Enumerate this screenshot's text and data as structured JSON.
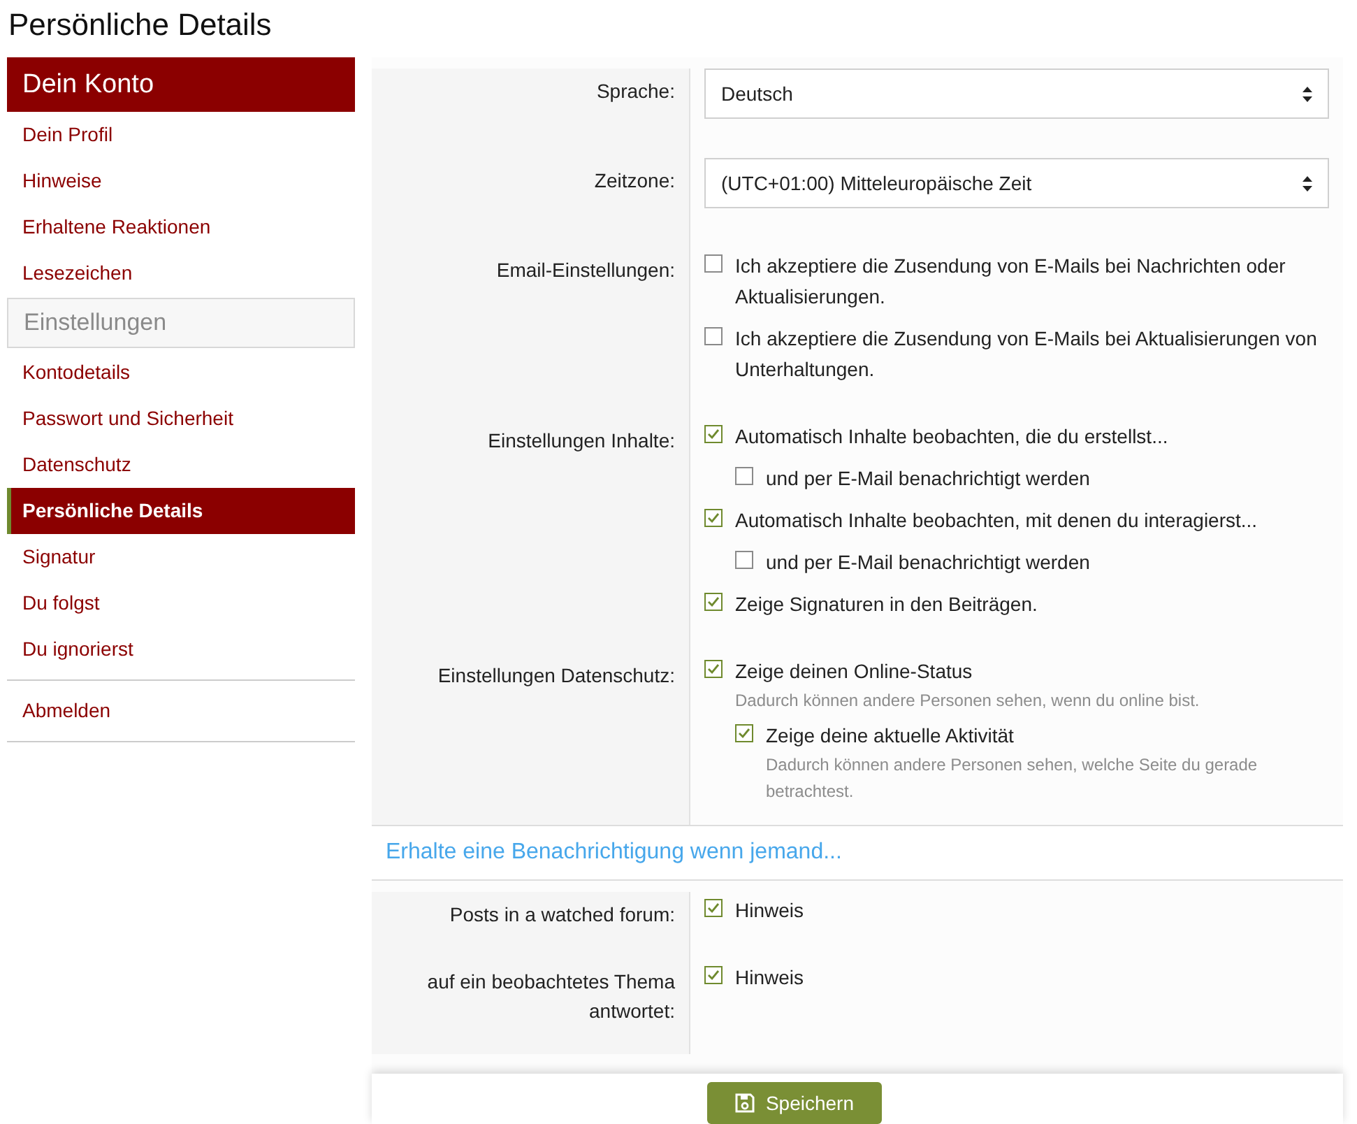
{
  "page_title": "Persönliche Details",
  "sidebar": {
    "items": [
      {
        "kind": "header",
        "label": "Dein Konto"
      },
      {
        "kind": "link",
        "label": "Dein Profil",
        "selected": false
      },
      {
        "kind": "link",
        "label": "Hinweise",
        "selected": false
      },
      {
        "kind": "link",
        "label": "Erhaltene Reaktionen",
        "selected": false
      },
      {
        "kind": "link",
        "label": "Lesezeichen",
        "selected": false
      },
      {
        "kind": "section",
        "label": "Einstellungen"
      },
      {
        "kind": "link",
        "label": "Kontodetails",
        "selected": false
      },
      {
        "kind": "link",
        "label": "Passwort und Sicherheit",
        "selected": false
      },
      {
        "kind": "link",
        "label": "Datenschutz",
        "selected": false
      },
      {
        "kind": "link",
        "label": "Persönliche Details",
        "selected": true
      },
      {
        "kind": "link",
        "label": "Signatur",
        "selected": false
      },
      {
        "kind": "link",
        "label": "Du folgst",
        "selected": false
      },
      {
        "kind": "link",
        "label": "Du ignorierst",
        "selected": false
      },
      {
        "kind": "divider"
      },
      {
        "kind": "link",
        "label": "Abmelden",
        "selected": false
      }
    ]
  },
  "settings": [
    {
      "kind": "select",
      "label": "Sprache:",
      "value": "Deutsch"
    },
    {
      "kind": "select",
      "label": "Zeitzone:",
      "value": "(UTC+01:00) Mitteleuropäische Zeit"
    },
    {
      "kind": "checks",
      "label": "Email-Einstellungen:",
      "options": [
        {
          "label": "Ich akzeptiere die Zusendung von E-Mails bei Nachrichten oder Aktualisierungen.",
          "checked": false
        },
        {
          "label": "Ich akzeptiere die Zusendung von E-Mails bei Aktualisierungen von Unterhaltungen.",
          "checked": false
        }
      ]
    },
    {
      "kind": "checks",
      "label": "Einstellungen Inhalte:",
      "options": [
        {
          "label": "Automatisch Inhalte beobachten, die du erstellst...",
          "checked": true,
          "children": [
            {
              "label": "und per E-Mail benachrichtigt werden",
              "checked": false
            }
          ]
        },
        {
          "label": "Automatisch Inhalte beobachten, mit denen du interagierst...",
          "checked": true,
          "children": [
            {
              "label": "und per E-Mail benachrichtigt werden",
              "checked": false
            }
          ]
        },
        {
          "label": "Zeige Signaturen in den Beiträgen.",
          "checked": true
        }
      ]
    },
    {
      "kind": "checks",
      "label": "Einstellungen Datenschutz:",
      "options": [
        {
          "label": "Zeige deinen Online-Status",
          "checked": true,
          "hint": "Dadurch können andere Personen sehen, wenn du online bist.",
          "children": [
            {
              "label": "Zeige deine aktuelle Aktivität",
              "checked": true,
              "hint": "Dadurch können andere Personen sehen, welche Seite du gerade betrachtest."
            }
          ]
        }
      ]
    }
  ],
  "notifications": {
    "heading": "Erhalte eine Benachrichtigung wenn jemand...",
    "rows": [
      {
        "label": "Posts in a watched forum:",
        "options": [
          {
            "label": "Hinweis",
            "checked": true
          }
        ]
      },
      {
        "label": "auf ein beobachtetes Thema antwortet:",
        "options": [
          {
            "label": "Hinweis",
            "checked": true
          }
        ]
      }
    ]
  },
  "save_button": "Speichern"
}
